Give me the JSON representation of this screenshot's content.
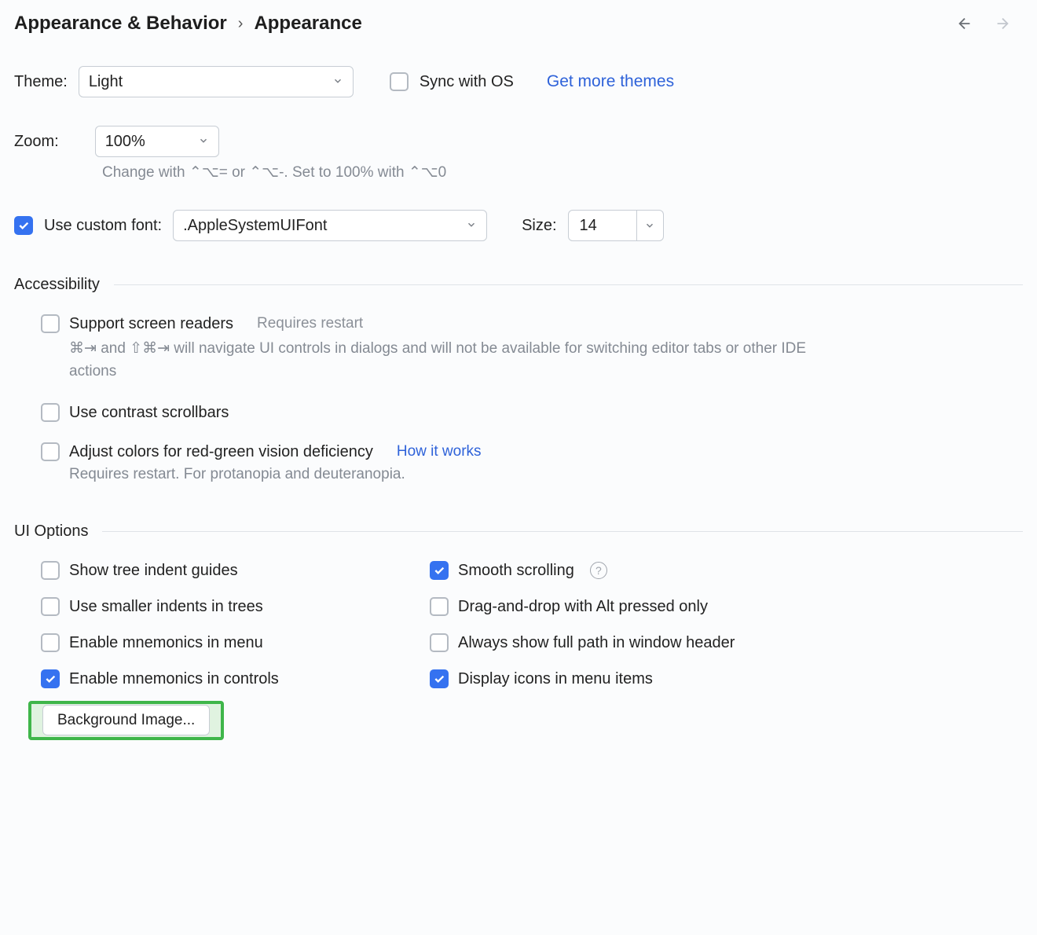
{
  "breadcrumb": {
    "parent": "Appearance & Behavior",
    "current": "Appearance"
  },
  "theme": {
    "label": "Theme:",
    "value": "Light",
    "sync_label": "Sync with OS",
    "sync_checked": false,
    "more_link": "Get more themes"
  },
  "zoom": {
    "label": "Zoom:",
    "value": "100%",
    "hint": "Change with ⌃⌥= or ⌃⌥-. Set to 100% with ⌃⌥0"
  },
  "font": {
    "use_custom_label": "Use custom font:",
    "use_custom_checked": true,
    "family": ".AppleSystemUIFont",
    "size_label": "Size:",
    "size_value": "14"
  },
  "accessibility": {
    "title": "Accessibility",
    "screen_readers": {
      "label": "Support screen readers",
      "checked": false,
      "requires": "Requires restart",
      "hint": "⌘⇥ and ⇧⌘⇥ will navigate UI controls in dialogs and will not be available for switching editor tabs or other IDE actions"
    },
    "contrast_scrollbars": {
      "label": "Use contrast scrollbars",
      "checked": false
    },
    "color_deficiency": {
      "label": "Adjust colors for red-green vision deficiency",
      "checked": false,
      "link": "How it works",
      "hint": "Requires restart. For protanopia and deuteranopia."
    }
  },
  "ui_options": {
    "title": "UI Options",
    "left": [
      {
        "key": "tree_guides",
        "label": "Show tree indent guides",
        "checked": false
      },
      {
        "key": "smaller_indents",
        "label": "Use smaller indents in trees",
        "checked": false
      },
      {
        "key": "mnemonics_menu",
        "label": "Enable mnemonics in menu",
        "checked": false
      },
      {
        "key": "mnemonics_controls",
        "label": "Enable mnemonics in controls",
        "checked": true
      }
    ],
    "right": [
      {
        "key": "smooth_scrolling",
        "label": "Smooth scrolling",
        "checked": true,
        "help": true
      },
      {
        "key": "dnd_alt",
        "label": "Drag-and-drop with Alt pressed only",
        "checked": false
      },
      {
        "key": "full_path",
        "label": "Always show full path in window header",
        "checked": false
      },
      {
        "key": "icons_menu",
        "label": "Display icons in menu items",
        "checked": true
      }
    ],
    "background_button": "Background Image..."
  }
}
